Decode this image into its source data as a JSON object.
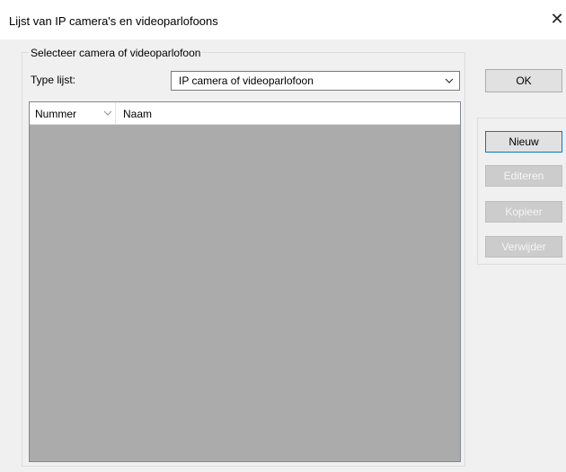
{
  "window": {
    "title": "Lijst van IP camera's en videoparlofoons",
    "close_symbol": "✕"
  },
  "group": {
    "legend": "Selecteer camera of videoparlofoon",
    "type_label": "Type lijst:",
    "type_value": "IP camera of videoparlofoon"
  },
  "list": {
    "columns": [
      "Nummer",
      "Naam"
    ],
    "rows": []
  },
  "buttons": {
    "ok": "OK",
    "nieuw": "Nieuw",
    "editeren": "Editeren",
    "kopieer": "Kopieer",
    "verwijder": "Verwijder"
  },
  "icons": {
    "close": "close-icon",
    "dropdown": "chevron-down-icon",
    "sort": "sort-down-icon"
  }
}
